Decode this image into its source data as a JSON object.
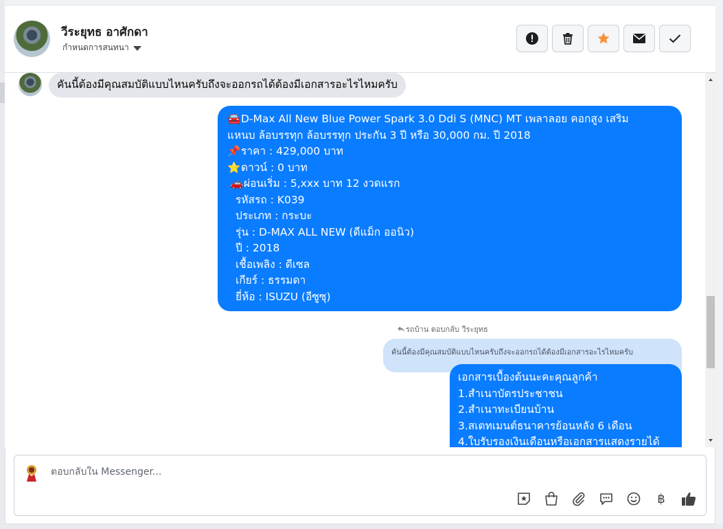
{
  "header": {
    "name": "วีระยุทธ อาศักดา",
    "subtitle": "กำหนดการสนทนา",
    "actions": [
      {
        "icon": "alert-icon",
        "label": "report"
      },
      {
        "icon": "trash-icon",
        "label": "delete"
      },
      {
        "icon": "star-icon",
        "label": "star",
        "color": "#f7923a"
      },
      {
        "icon": "mail-icon",
        "label": "mark-unread"
      },
      {
        "icon": "check-icon",
        "label": "done"
      }
    ]
  },
  "messages": {
    "incoming_1": "คันนี้ต้องมีคุณสมบัติแบบไหนครับถึงจะออกรถได้ต้องมีเอกสารอะไรไหมครับ",
    "listing": {
      "title_line1": "D-Max All New Blue Power Spark 3.0 Ddi S (MNC) MT เพลาลอย คอกสูง เสริม",
      "title_line2": "แหนบ ล้อบรรทุก ล้อบรรทุก ประกัน 3 ปี หรือ 30,000 กม. ปี 2018",
      "price": "ราคา : 429,000 บาท",
      "down": "ดาวน์ : 0 บาท",
      "installment": "ผ่อนเริ่ม : 5,xxx บาท 12 งวดแรก",
      "code": "รหัสรถ : K039",
      "type": "ประเภท : กระบะ",
      "model": "รุ่น : D-MAX ALL NEW (ดีแม็ก ออนิว)",
      "year": "ปี : 2018",
      "fuel": "เชื้อเพลิง : ดีเซล",
      "gear": "เกียร์ : ธรรมดา",
      "brand": "ยี่ห้อ : ISUZU (อีซูซุ)"
    },
    "reply_meta": "รถบ้าน ตอบกลับ วีระยุทธ",
    "quoted": "คันนี้ต้องมีคุณสมบัติแบบไหนครับถึงจะออกรถได้ต้องมีเอกสารอะไรไหมครับ",
    "docs": {
      "line1": "เอกสารเบื้องต้นนะคะคุณลูกค้า",
      "line2": "1.สำเนาบัตรประชาชน",
      "line3": "2.สำเนาทะเบียนบ้าน",
      "line4": "3.สเตทเมนต์ธนาคารย้อนหลัง 6 เดือน",
      "line5": "4.ใบรับรองเงินเดือนหรือเอกสารแสดงรายได้"
    }
  },
  "composer": {
    "placeholder": "ตอบกลับใน Messenger...",
    "tools": [
      "sticker-icon",
      "bag-icon",
      "attach-icon",
      "saved-reply-icon",
      "emoji-icon",
      "baht-icon",
      "like-icon"
    ],
    "baht": "฿"
  },
  "colors": {
    "outgoing": "#0a7cff",
    "incoming": "#e4e6eb",
    "quote": "#cfe3fb",
    "star": "#f7923a"
  }
}
